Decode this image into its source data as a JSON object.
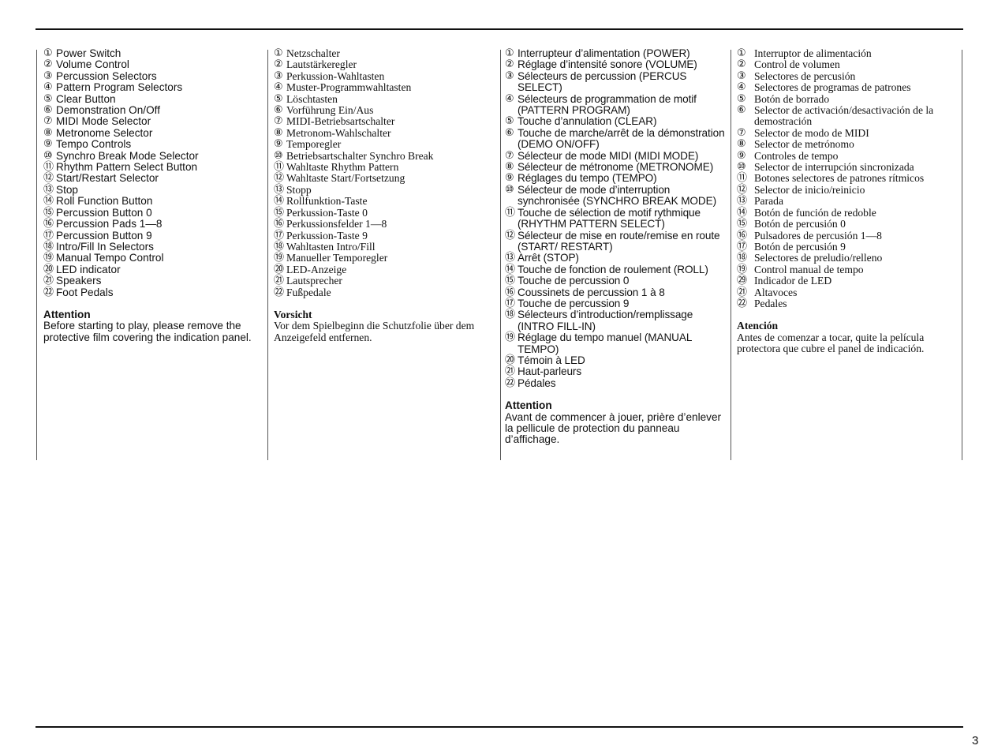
{
  "page_number": "3",
  "columns": {
    "english": {
      "items": [
        {
          "marker": "①",
          "text": "Power Switch"
        },
        {
          "marker": "②",
          "text": "Volume Control"
        },
        {
          "marker": "③",
          "text": "Percussion Selectors"
        },
        {
          "marker": "④",
          "text": "Pattern Program Selectors"
        },
        {
          "marker": "⑤",
          "text": "Clear Button"
        },
        {
          "marker": "⑥",
          "text": "Demonstration On/Off"
        },
        {
          "marker": "⑦",
          "text": "MIDI Mode Selector"
        },
        {
          "marker": "⑧",
          "text": "Metronome Selector"
        },
        {
          "marker": "⑨",
          "text": "Tempo Controls"
        },
        {
          "marker": "⑩",
          "text": "Synchro Break Mode Selector"
        },
        {
          "marker": "⑪",
          "text": "Rhythm Pattern Select Button"
        },
        {
          "marker": "⑫",
          "text": "Start/Restart Selector"
        },
        {
          "marker": "⑬",
          "text": "Stop"
        },
        {
          "marker": "⑭",
          "text": "Roll Function Button"
        },
        {
          "marker": "⑮",
          "text": "Percussion Button 0"
        },
        {
          "marker": "⑯",
          "text": "Percussion Pads 1—8"
        },
        {
          "marker": "⑰",
          "text": "Percussion Button 9"
        },
        {
          "marker": "⑱",
          "text": "Intro/Fill In Selectors"
        },
        {
          "marker": "⑲",
          "text": "Manual Tempo Control"
        },
        {
          "marker": "⑳",
          "text": "LED indicator"
        },
        {
          "marker": "㉑",
          "text": "Speakers"
        },
        {
          "marker": "㉒",
          "text": "Foot Pedals"
        }
      ],
      "note_title": "Attention",
      "note_body": "Before starting to play, please remove the protective film covering the indication panel."
    },
    "german": {
      "items": [
        {
          "marker": "①",
          "text": "Netzschalter"
        },
        {
          "marker": "②",
          "text": "Lautstärkeregler"
        },
        {
          "marker": "③",
          "text": "Perkussion-Wahltasten"
        },
        {
          "marker": "④",
          "text": "Muster-Programmwahltasten"
        },
        {
          "marker": "⑤",
          "text": "Löschtasten"
        },
        {
          "marker": "⑥",
          "text": "Vorführung Ein/Aus"
        },
        {
          "marker": "⑦",
          "text": "MIDI-Betriebsartschalter"
        },
        {
          "marker": "⑧",
          "text": "Metronom-Wahlschalter"
        },
        {
          "marker": "⑨",
          "text": "Temporegler"
        },
        {
          "marker": "⑩",
          "text": "Betriebsartschalter Synchro Break"
        },
        {
          "marker": "⑪",
          "text": "Wahltaste Rhythm Pattern"
        },
        {
          "marker": "⑫",
          "text": "Wahltaste Start/Fortsetzung"
        },
        {
          "marker": "⑬",
          "text": "Stopp"
        },
        {
          "marker": "⑭",
          "text": "Rollfunktion-Taste"
        },
        {
          "marker": "⑮",
          "text": "Perkussion-Taste 0"
        },
        {
          "marker": "⑯",
          "text": "Perkussionsfelder 1—8"
        },
        {
          "marker": "⑰",
          "text": "Perkussion-Taste 9"
        },
        {
          "marker": "⑱",
          "text": "Wahltasten Intro/Fill"
        },
        {
          "marker": "⑲",
          "text": "Manueller Temporegler"
        },
        {
          "marker": "⑳",
          "text": "LED-Anzeige"
        },
        {
          "marker": "㉑",
          "text": "Lautsprecher"
        },
        {
          "marker": "㉒",
          "text": "Fußpedale"
        }
      ],
      "note_title": "Vorsicht",
      "note_body": "Vor dem Spielbeginn die Schutzfolie über dem Anzeigefeld entfernen."
    },
    "french": {
      "items": [
        {
          "marker": "①",
          "text": "Interrupteur d’alimentation (POWER)"
        },
        {
          "marker": "②",
          "text": "Réglage d’intensité sonore (VOLUME)"
        },
        {
          "marker": "③",
          "text": "Sélecteurs de percussion (PERCUS SELECT)"
        },
        {
          "marker": "④",
          "text": "Sélecteurs de programmation de motif (PATTERN PROGRAM)"
        },
        {
          "marker": "⑤",
          "text": "Touche d’annulation (CLEAR)"
        },
        {
          "marker": "⑥",
          "text": "Touche de marche/arrêt de la démonstration (DEMO ON/OFF)"
        },
        {
          "marker": "⑦",
          "text": "Sélecteur de mode MIDI (MIDI MODE)"
        },
        {
          "marker": "⑧",
          "text": "Sélecteur de métronome (METRONOME)"
        },
        {
          "marker": "⑨",
          "text": "Réglages du tempo (TEMPO)"
        },
        {
          "marker": "⑩",
          "text": "Sélecteur de mode d’interruption synchronisée (SYNCHRO BREAK MODE)"
        },
        {
          "marker": "⑪",
          "text": "Touche de sélection de motif rythmique (RHYTHM PATTERN SELECT)"
        },
        {
          "marker": "⑫",
          "text": "Sélecteur de mise en route/remise en route (START/ RESTART)"
        },
        {
          "marker": "⑬",
          "text": "Arrêt (STOP)"
        },
        {
          "marker": "⑭",
          "text": "Touche de fonction de roulement (ROLL)"
        },
        {
          "marker": "⑮",
          "text": "Touche de percussion 0"
        },
        {
          "marker": "⑯",
          "text": "Coussinets de percussion 1 à 8"
        },
        {
          "marker": "⑰",
          "text": "Touche de percussion 9"
        },
        {
          "marker": "⑱",
          "text": "Sélecteurs d’introduction/remplissage (INTRO FILL-IN)"
        },
        {
          "marker": "⑲",
          "text": "Réglage du tempo manuel (MANUAL TEMPO)"
        },
        {
          "marker": "⑳",
          "text": "Témoin à LED"
        },
        {
          "marker": "㉑",
          "text": "Haut-parleurs"
        },
        {
          "marker": "㉒",
          "text": "Pédales"
        }
      ],
      "note_title": "Attention",
      "note_body": "Avant de commencer à jouer, prière d’enlever la pellicule de protection du panneau d’affichage."
    },
    "spanish": {
      "items": [
        {
          "marker": "①",
          "text": "Interruptor de alimentación"
        },
        {
          "marker": "②",
          "text": "Control de volumen"
        },
        {
          "marker": "③",
          "text": "Selectores de percusión"
        },
        {
          "marker": "④",
          "text": "Selectores de programas de patrones"
        },
        {
          "marker": "⑤",
          "text": "Botón de borrado"
        },
        {
          "marker": "⑥",
          "text": "Selector de activación/desactivación de la demostración"
        },
        {
          "marker": "⑦",
          "text": "Selector de modo de MIDI"
        },
        {
          "marker": "⑧",
          "text": "Selector de metrónomo"
        },
        {
          "marker": "⑨",
          "text": "Controles de tempo"
        },
        {
          "marker": "⑩",
          "text": "Selector de interrupción sincronizada"
        },
        {
          "marker": "⑪",
          "text": "Botones selectores de patrones rítmicos"
        },
        {
          "marker": "⑫",
          "text": "Selector de inicio/reinicio"
        },
        {
          "marker": "⑬",
          "text": "Parada"
        },
        {
          "marker": "⑭",
          "text": "Botón de función de redoble"
        },
        {
          "marker": "⑮",
          "text": "Botón de percusión 0"
        },
        {
          "marker": "⑯",
          "text": "Pulsadores de percusión 1—8"
        },
        {
          "marker": "⑰",
          "text": "Botón de percusión 9"
        },
        {
          "marker": "⑱",
          "text": "Selectores de preludio/relleno"
        },
        {
          "marker": "⑲",
          "text": "Control manual de tempo"
        },
        {
          "marker": "㉙",
          "text": "Indicador de LED"
        },
        {
          "marker": "㉑",
          "text": "Altavoces"
        },
        {
          "marker": "㉒",
          "text": "Pedales"
        }
      ],
      "note_title": "Atención",
      "note_body": "Antes de comenzar a tocar, quite la película protectora que cubre el panel de indicación."
    }
  }
}
